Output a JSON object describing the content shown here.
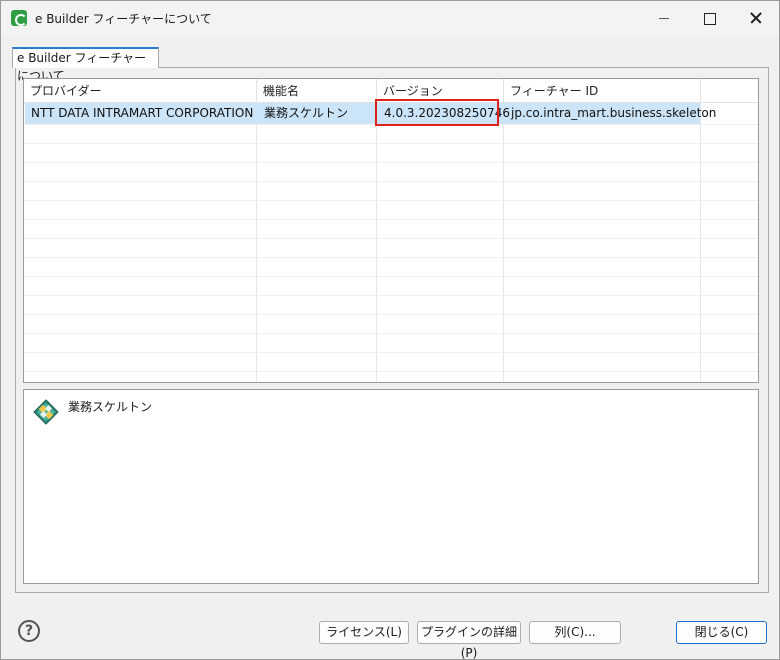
{
  "window": {
    "title": "e Builder フィーチャーについて"
  },
  "tab": {
    "label": "e Builder フィーチャーについて"
  },
  "table": {
    "columns": [
      "プロバイダー",
      "機能名",
      "バージョン",
      "フィーチャー ID"
    ],
    "rows": [
      {
        "provider": "NTT DATA INTRAMART CORPORATION",
        "name": "業務スケルトン",
        "version": "4.0.3.202308250746",
        "feature_id": "jp.co.intra_mart.business.skeleton"
      }
    ]
  },
  "description": {
    "title": "業務スケルトン"
  },
  "buttons": {
    "license": "ライセンス(L)",
    "plugin_details": "プラグインの詳細(P)",
    "columns": "列(C)...",
    "close": "閉じる(C)"
  },
  "icons": {
    "app": "app-icon",
    "help": "help-icon",
    "feature": "puzzle-icon"
  },
  "colors": {
    "selection": "#cce4f7",
    "highlight": "#e0201c",
    "accent": "#2d7bd0"
  }
}
